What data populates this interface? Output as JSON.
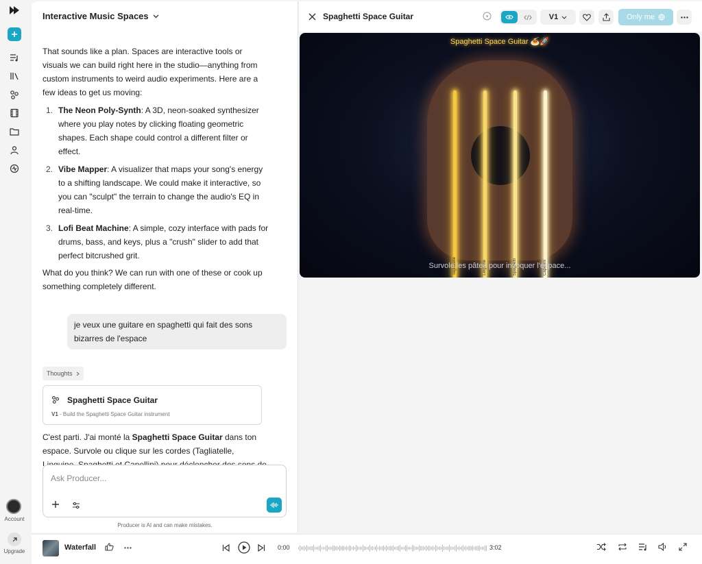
{
  "sidebar": {
    "account_label": "Account",
    "upgrade_label": "Upgrade"
  },
  "chat": {
    "title": "Interactive Music Spaces",
    "intro": "That sounds like a plan. Spaces are interactive tools or visuals we can build right here in the studio—anything from custom instruments to weird audio experiments. Here are a few ideas to get us moving:",
    "ideas": [
      {
        "num": "1.",
        "name": "The Neon Poly-Synth",
        "desc": ": A 3D, neon-soaked synthesizer where you play notes by clicking floating geometric shapes. Each shape could control a different filter or effect."
      },
      {
        "num": "2.",
        "name": "Vibe Mapper",
        "desc": ": A visualizer that maps your song's energy to a shifting landscape. We could make it interactive, so you can \"sculpt\" the terrain to change the audio's EQ in real-time."
      },
      {
        "num": "3.",
        "name": "Lofi Beat Machine",
        "desc": ": A simple, cozy interface with pads for drums, bass, and keys, plus a \"crush\" slider to add that perfect bitcrushed grit."
      }
    ],
    "outro": "What do you think? We can run with one of these or cook up something completely different.",
    "user_message": "je veux une guitare en spaghetti qui fait des sons bizarres de l'espace",
    "thoughts_label": "Thoughts",
    "card": {
      "title": "Spaghetti Space Guitar",
      "version": "V1",
      "desc": " - Build the Spaghetti Space Guitar instrument"
    },
    "reply_pre": "C'est parti. J'ai monté la ",
    "reply_bold": "Spaghetti Space Guitar",
    "reply_post": " dans ton espace. Survole ou clique sur les cordes (Tagliatelle, Linguine, Spaghetti et Capellini) pour déclencher des sons de synthé",
    "input_placeholder": "Ask Producer...",
    "disclaimer": "Producer is AI and can make mistakes."
  },
  "panel": {
    "title": "Spaghetti Space Guitar",
    "version": "V1",
    "share_label": "Only me",
    "stage_title": "Spaghetti Space Guitar 🍝🚀",
    "strings": [
      {
        "name": "Tagliatelle",
        "color": "#f5c842"
      },
      {
        "name": "Linguine",
        "color": "#f7d66a"
      },
      {
        "name": "Spaghetti",
        "color": "#f9e48e"
      },
      {
        "name": "Capellini",
        "color": "#fdf3cf"
      }
    ],
    "hint": "Survole les pâtes pour invoquer l'espace..."
  },
  "player": {
    "song": "Waterfall",
    "time_current": "0:00",
    "time_total": "3:02"
  },
  "colors": {
    "accent": "#1ba6c4",
    "accent_light": "#a7d9e6",
    "guitar_body": "#5a3a2c"
  }
}
